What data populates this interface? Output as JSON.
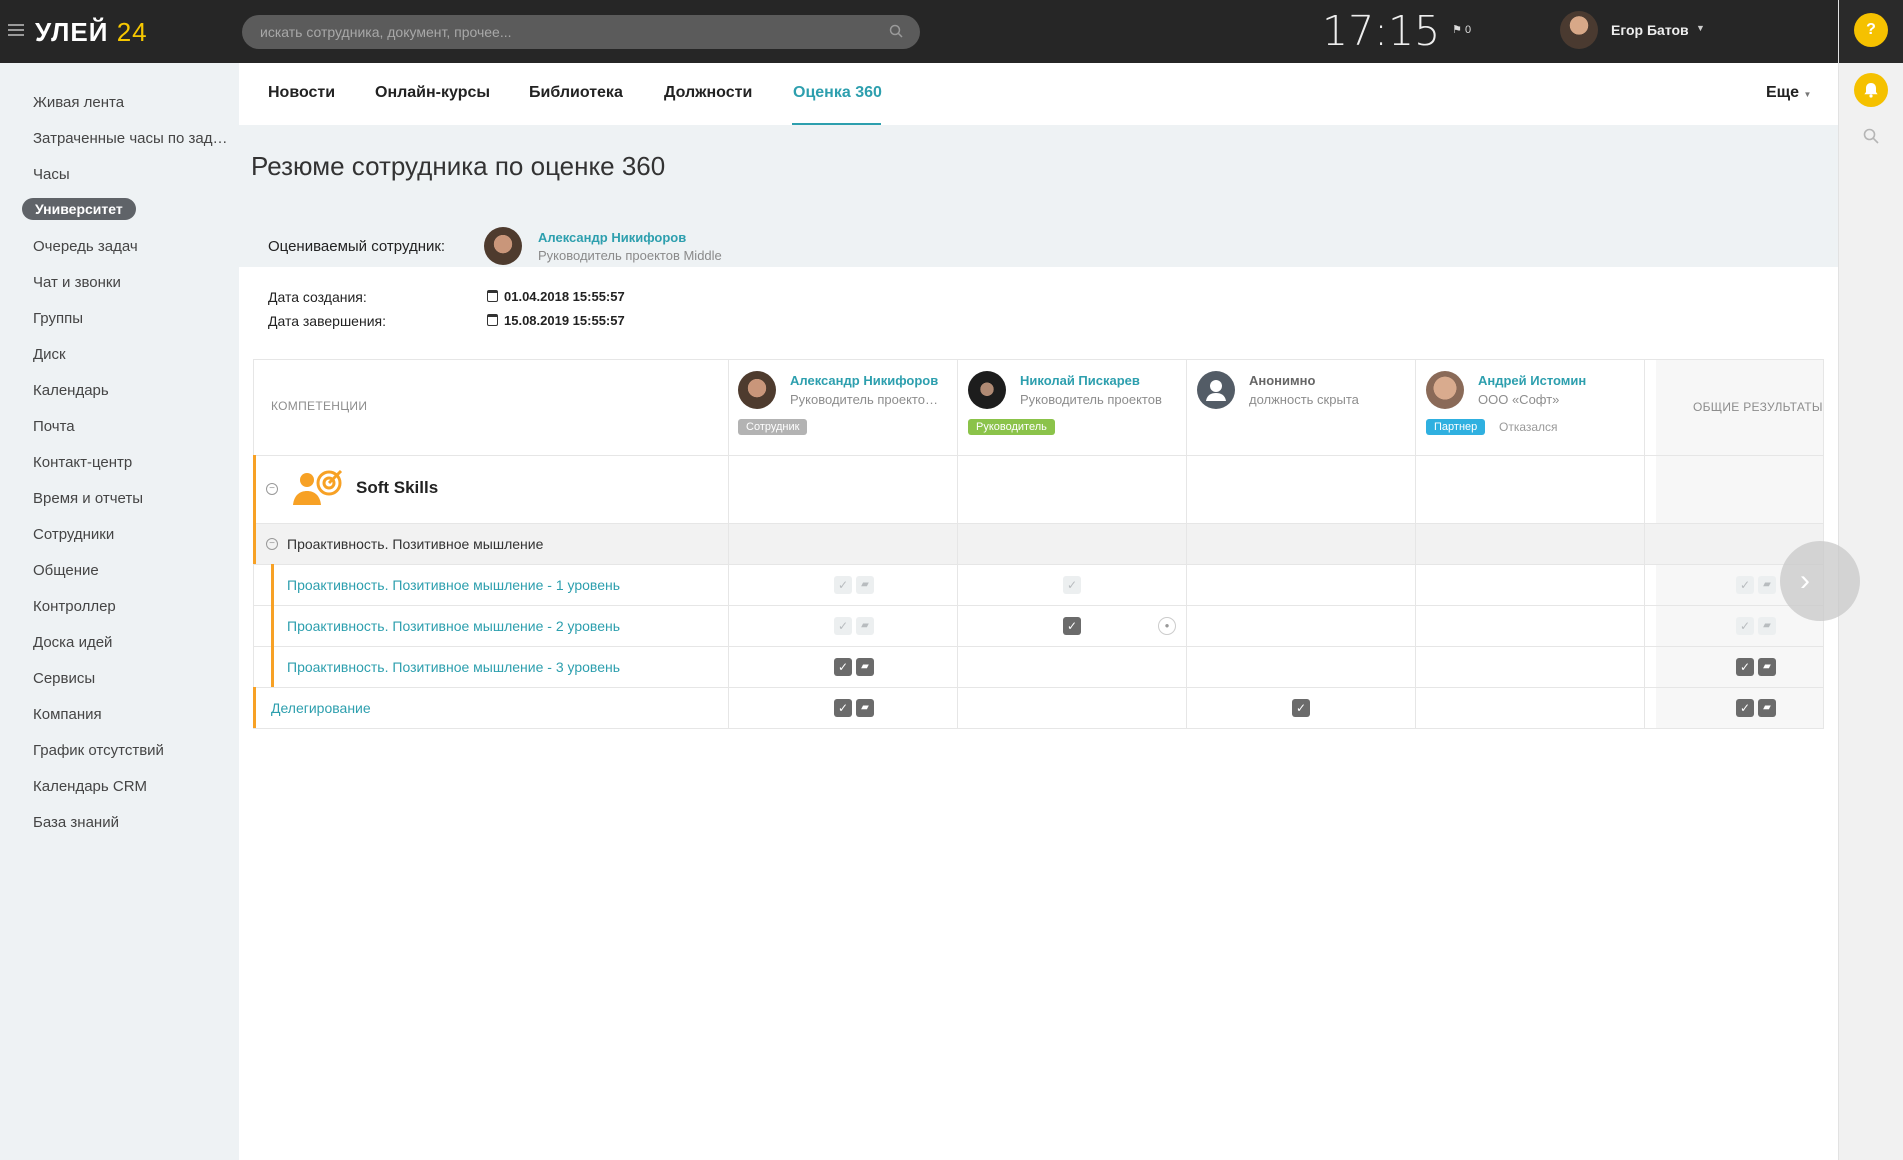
{
  "topbar": {
    "logo_main": "УЛЕЙ",
    "logo_num": "24",
    "search_placeholder": "искать сотрудника, документ, прочее...",
    "clock": "17:15",
    "flag_count": "0",
    "user_name": "Егор Батов"
  },
  "rightbar": {
    "help": "?"
  },
  "sidebar": {
    "items": [
      {
        "label": "Живая лента"
      },
      {
        "label": "Затраченные часы по задачам"
      },
      {
        "label": "Часы"
      },
      {
        "label": "Университет",
        "active": true
      },
      {
        "label": "Очередь задач"
      },
      {
        "label": "Чат и звонки"
      },
      {
        "label": "Группы"
      },
      {
        "label": "Диск"
      },
      {
        "label": "Календарь"
      },
      {
        "label": "Почта"
      },
      {
        "label": "Контакт-центр"
      },
      {
        "label": "Время и отчеты"
      },
      {
        "label": "Сотрудники"
      },
      {
        "label": "Общение"
      },
      {
        "label": "Контроллер"
      },
      {
        "label": "Доска идей"
      },
      {
        "label": "Сервисы"
      },
      {
        "label": "Компания"
      },
      {
        "label": "График отсутствий"
      },
      {
        "label": "Календарь CRM"
      },
      {
        "label": "База знаний"
      }
    ]
  },
  "tabs": {
    "items": [
      "Новости",
      "Онлайн-курсы",
      "Библиотека",
      "Должности",
      "Оценка 360"
    ],
    "active": "Оценка 360",
    "more": "Еще"
  },
  "page": {
    "title": "Резюме сотрудника по оценке 360",
    "evaluated_label": "Оцениваемый сотрудник:",
    "employee_name": "Александр Никифоров",
    "employee_role": "Руководитель проектов Middle",
    "created_label": "Дата создания:",
    "created_value": "01.04.2018 15:55:57",
    "finished_label": "Дата завершения:",
    "finished_value": "15.08.2019 15:55:57"
  },
  "table": {
    "competencies_header": "КОМПЕТЕНЦИИ",
    "results_header": "ОБЩИЕ РЕЗУЛЬТАТЫ",
    "evaluators": [
      {
        "name": "Александр Никифоров",
        "role": "Руководитель проектов Middle",
        "badge": "Сотрудник",
        "badge_color": "#b3b3b3"
      },
      {
        "name": "Николай Пискарев",
        "role": "Руководитель проектов",
        "badge": "Руководитель",
        "badge_color": "#8bc34a"
      },
      {
        "name": "Анонимно",
        "role": "должность скрыта",
        "badge": "",
        "badge_color": ""
      },
      {
        "name": "Андрей Истомин",
        "role": "ООО «Софт»",
        "badge": "Партнер",
        "badge_color": "#2fb0e0",
        "status": "Отказался"
      }
    ],
    "category": "Soft Skills",
    "subcategory": "Проактивность. Позитивное мышление",
    "rows": [
      {
        "label": "Проактивность. Позитивное мышление - 1 уровень"
      },
      {
        "label": "Проактивность. Позитивное мышление - 2 уровень"
      },
      {
        "label": "Проактивность. Позитивное мышление - 3 уровень"
      },
      {
        "label": "Делегирование"
      }
    ]
  },
  "colors": {
    "accent": "#2d9fae",
    "orange": "#f7a125",
    "yellow": "#f5c100"
  }
}
